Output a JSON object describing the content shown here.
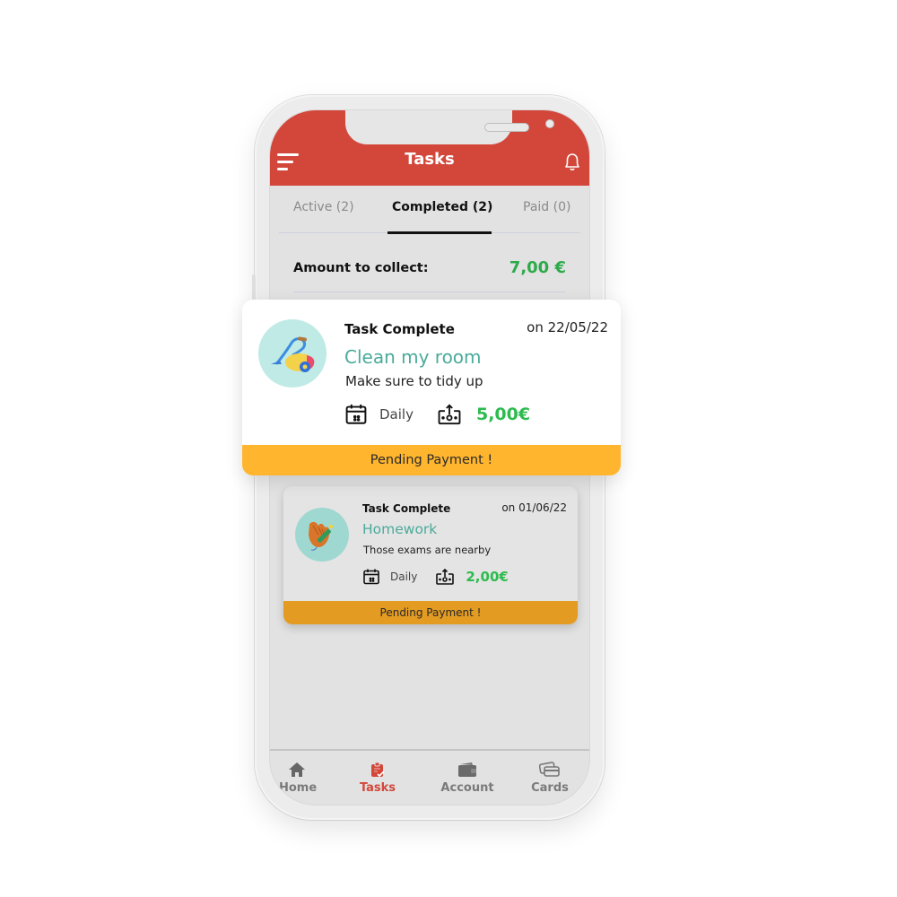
{
  "header": {
    "title": "Tasks",
    "menu_icon": "menu-icon",
    "bell_icon": "bell-icon"
  },
  "tabs": [
    {
      "label": "Active (2)",
      "active": false
    },
    {
      "label": "Completed (2)",
      "active": true
    },
    {
      "label": "Paid (0)",
      "active": false
    }
  ],
  "summary": {
    "label": "Amount to collect:",
    "value": "7,00 €"
  },
  "tasks": [
    {
      "status": "Task Complete",
      "date": "on 22/05/22",
      "name": "Clean my room",
      "description": "Make sure to tidy up",
      "frequency": "Daily",
      "reward": "5,00€",
      "banner": "Pending Payment !",
      "icon": "vacuum-cleaner-icon"
    },
    {
      "status": "Task Complete",
      "date": "on 01/06/22",
      "name": "Homework",
      "description": "Those exams are nearby",
      "frequency": "Daily",
      "reward": "2,00€",
      "banner": "Pending Payment !",
      "icon": "hand-pencil-icon"
    }
  ],
  "bottom_nav": [
    {
      "label": "Home",
      "icon": "home-icon",
      "active": false
    },
    {
      "label": "Tasks",
      "icon": "clipboard-check-icon",
      "active": true
    },
    {
      "label": "Account",
      "icon": "wallet-icon",
      "active": false
    },
    {
      "label": "Cards",
      "icon": "cards-icon",
      "active": false
    }
  ],
  "colors": {
    "brand_red": "#d3473b",
    "amount_green": "#2eaa4a",
    "task_title_teal": "#4aab9b",
    "pending_yellow": "#ffb52e",
    "pending_dim": "#e39b22"
  }
}
